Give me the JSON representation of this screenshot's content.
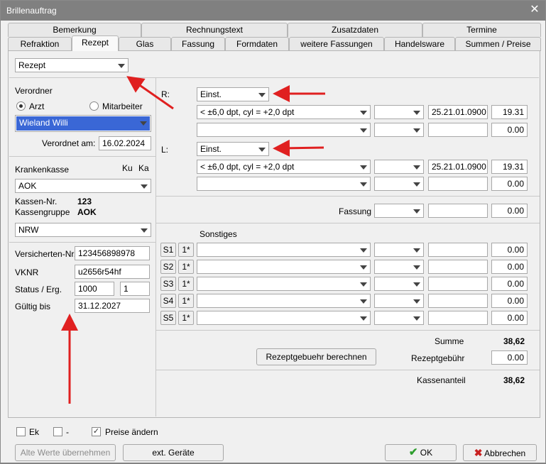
{
  "window": {
    "title": "Brillenauftrag",
    "close_glyph": "✕"
  },
  "tabs_row1": [
    "Bemerkung",
    "Rechnungstext",
    "Zusatzdaten",
    "Termine"
  ],
  "tabs_row2": [
    "Refraktion",
    "Rezept",
    "Glas",
    "Fassung",
    "Formdaten",
    "weitere Fassungen",
    "Handelsware",
    "Summen / Preise"
  ],
  "active_tab": "Rezept",
  "type_select": "Rezept",
  "verordner": {
    "heading": "Verordner",
    "radio_arzt": "Arzt",
    "radio_mitarbeiter": "Mitarbeiter",
    "selected_radio": "Arzt",
    "name": "Wieland Willi",
    "date_label": "Verordnet am:",
    "date_value": "16.02.2024"
  },
  "kasse": {
    "heading": "Krankenkasse",
    "ku": "Ku",
    "ka": "Ka",
    "name": "AOK",
    "nr_label": "Kassen-Nr.",
    "nr_value": "123",
    "gruppe_label": "Kassengruppe",
    "gruppe_value": "AOK",
    "region": "NRW"
  },
  "versicherung": {
    "vnr_label": "Versicherten-Nr.",
    "vnr_value": "123456898978",
    "vknr_label": "VKNR",
    "vknr_value": "u2656r54hf",
    "status_label": "Status / Erg.",
    "status_value": "1000",
    "erg_value": "1",
    "gueltig_label": "Gültig bis",
    "gueltig_value": "31.12.2027"
  },
  "right": {
    "r_label": "R:",
    "r_select": "Einst.",
    "r_row1": {
      "desc": "< ±6,0 dpt, cyl = +2,0 dpt",
      "code": "25.21.01.0900",
      "price": "19.31"
    },
    "r_row2": {
      "desc": "",
      "code": "",
      "price": "0.00"
    },
    "l_label": "L:",
    "l_select": "Einst.",
    "l_row1": {
      "desc": "< ±6,0 dpt, cyl = +2,0 dpt",
      "code": "25.21.01.0900",
      "price": "19.31"
    },
    "l_row2": {
      "desc": "",
      "code": "",
      "price": "0.00"
    },
    "fassung_label": "Fassung",
    "fassung_price": "0.00",
    "sonstiges_label": "Sonstiges",
    "sonstiges": [
      {
        "btn": "S1",
        "star": "1*",
        "price": "0.00"
      },
      {
        "btn": "S2",
        "star": "1*",
        "price": "0.00"
      },
      {
        "btn": "S3",
        "star": "1*",
        "price": "0.00"
      },
      {
        "btn": "S4",
        "star": "1*",
        "price": "0.00"
      },
      {
        "btn": "S5",
        "star": "1*",
        "price": "0.00"
      }
    ],
    "summe_label": "Summe",
    "summe_value": "38,62",
    "calc_button": "Rezeptgebuehr berechnen",
    "gebuehr_label": "Rezeptgebühr",
    "gebuehr_value": "0.00",
    "kassenanteil_label": "Kassenanteil",
    "kassenanteil_value": "38,62"
  },
  "footer": {
    "ek": "Ek",
    "dash": "-",
    "preise": "Preise ändern",
    "preise_checked": true,
    "alte_werte": "Alte Werte übernehmen",
    "ext_geraete": "ext. Geräte",
    "ok": "OK",
    "abbrechen": "Abbrechen"
  },
  "colors": {
    "selection": "#3a67d6",
    "annotation_arrow": "#e02020",
    "ok_check": "#2e9e2e",
    "cancel_x": "#c82020"
  }
}
